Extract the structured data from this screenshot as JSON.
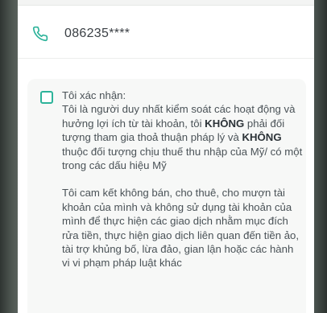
{
  "contact": {
    "phone_masked": "086235****"
  },
  "confirmation": {
    "heading": "Tôi xác nhận:",
    "para1_a": "Tôi là người duy nhất kiểm soát các hoạt động và hưởng lợi ích từ tài khoản, tôi ",
    "para1_bold1": "KHÔNG",
    "para1_b": " phải đối tượng tham gia thoả thuận pháp lý và ",
    "para1_bold2": "KHÔNG",
    "para1_c": " thuộc đối tượng chịu thuế thu nhập của Mỹ/ có một trong các dấu hiệu Mỹ",
    "para2": "Tôi cam kết không bán, cho thuê, cho mượn tài khoản của mình và không sử dụng tài khoản của mình để thực hiện các giao dịch nhằm mục đích rửa tiền, thực hiện giao dịch liên quan đến tiền ảo, tài trợ khủng bố, lừa đảo, gian lận hoặc các hành vi vi phạm pháp luật khác",
    "checked": false
  },
  "colors": {
    "accent": "#2db39a",
    "text": "#4a5257"
  },
  "icons": {
    "phone": "phone-icon"
  }
}
